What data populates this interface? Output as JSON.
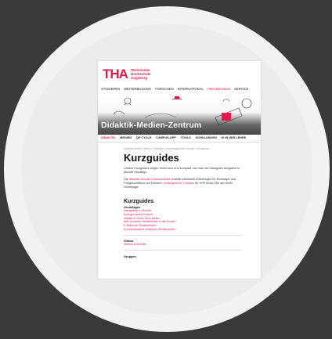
{
  "logo": {
    "mark": "TH",
    "mark_accent": "A",
    "line1": "Technische",
    "line2": "Hochschule",
    "line3": "Augsburg"
  },
  "nav": [
    "STUDIEREN",
    "WEITERBILDUNG",
    "FORSCHEN",
    "INTERNATIONAL",
    "HOCHSCHULE",
    "SERVICE"
  ],
  "nav_active": "HOCHSCHULE",
  "hero_title": "Didaktik-Medien-Zentrum",
  "subnav": [
    "DIDAKTIK",
    "MEDIEN",
    "QP CYCLE",
    "CAMPUS-APP",
    "TOOLS",
    "SCHULUNGEN",
    "KI IN DER LEHRE"
  ],
  "breadcrumb": "Didaktik-Medien-Zentrum / Didaktik / Lernmanagement / Moodle / Kurzguides",
  "page_title": "Kurzguides",
  "intro": "Unsere Kurzguides zeigen Ihnen kurz und kompakt, wie man die häufigsten Aufgaben in Moodle bewältigt.",
  "para2": {
    "before": "Die ",
    "link1": "offizielle Moodle-Dokumentation",
    "middle": " enthält exzellente Anleitungen für Einsteiger und Fortgeschrittene auf Deutsch. ",
    "link2": "Umfangreiche Tutorials",
    "after": " für HSP finden Sie auf deren Homepage."
  },
  "section_title": "Kurzguides",
  "groups": [
    {
      "title": "Grundlagen",
      "links": [
        "Navigation in Moodle",
        "Anlegen eines Kurses",
        "Inhalte in einen Kurs stellen",
        "Wie kommen Studierende in die Kurse?",
        "E-Mails an Studierenden",
        "Kommunikation zwischen Studierenden"
      ]
    },
    {
      "title": "Videos",
      "links": [
        "Videos & Moodle"
      ]
    },
    {
      "title": "Gruppen",
      "links": []
    }
  ],
  "colors": {
    "accent": "#e6194b",
    "background": "#3a3a3a"
  }
}
